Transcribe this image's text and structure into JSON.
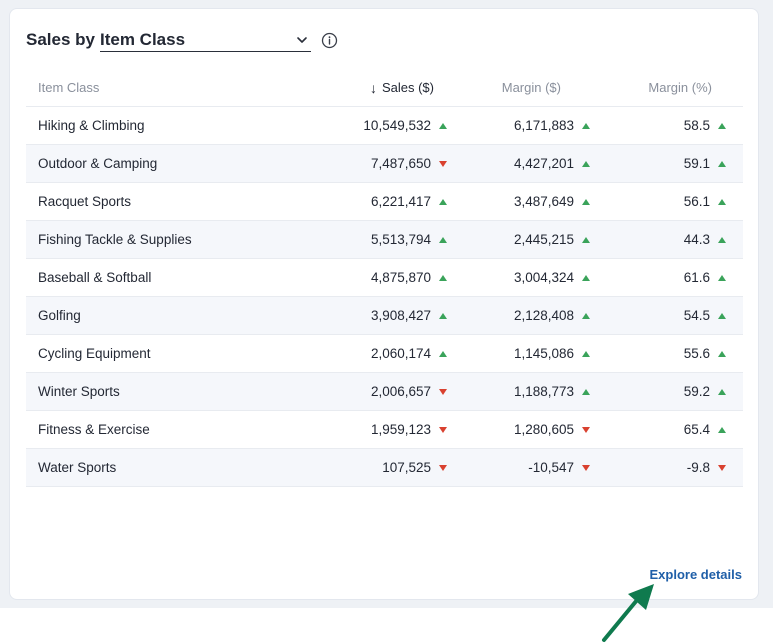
{
  "header": {
    "title_prefix": "Sales by",
    "dropdown_value": "Item Class"
  },
  "table": {
    "columns": {
      "item_class": "Item Class",
      "sales": "Sales ($)",
      "margin": "Margin ($)",
      "margin_pct": "Margin (%)"
    },
    "sort": {
      "column": "sales",
      "direction": "descending"
    },
    "rows": [
      {
        "item_class": "Hiking & Climbing",
        "sales": "10,549,532",
        "sales_trend": "up",
        "margin": "6,171,883",
        "margin_trend": "up",
        "margin_pct": "58.5",
        "pct_trend": "up"
      },
      {
        "item_class": "Outdoor & Camping",
        "sales": "7,487,650",
        "sales_trend": "down",
        "margin": "4,427,201",
        "margin_trend": "up",
        "margin_pct": "59.1",
        "pct_trend": "up"
      },
      {
        "item_class": "Racquet Sports",
        "sales": "6,221,417",
        "sales_trend": "up",
        "margin": "3,487,649",
        "margin_trend": "up",
        "margin_pct": "56.1",
        "pct_trend": "up"
      },
      {
        "item_class": "Fishing Tackle & Supplies",
        "sales": "5,513,794",
        "sales_trend": "up",
        "margin": "2,445,215",
        "margin_trend": "up",
        "margin_pct": "44.3",
        "pct_trend": "up"
      },
      {
        "item_class": "Baseball & Softball",
        "sales": "4,875,870",
        "sales_trend": "up",
        "margin": "3,004,324",
        "margin_trend": "up",
        "margin_pct": "61.6",
        "pct_trend": "up"
      },
      {
        "item_class": "Golfing",
        "sales": "3,908,427",
        "sales_trend": "up",
        "margin": "2,128,408",
        "margin_trend": "up",
        "margin_pct": "54.5",
        "pct_trend": "up"
      },
      {
        "item_class": "Cycling Equipment",
        "sales": "2,060,174",
        "sales_trend": "up",
        "margin": "1,145,086",
        "margin_trend": "up",
        "margin_pct": "55.6",
        "pct_trend": "up"
      },
      {
        "item_class": "Winter Sports",
        "sales": "2,006,657",
        "sales_trend": "down",
        "margin": "1,188,773",
        "margin_trend": "up",
        "margin_pct": "59.2",
        "pct_trend": "up"
      },
      {
        "item_class": "Fitness & Exercise",
        "sales": "1,959,123",
        "sales_trend": "down",
        "margin": "1,280,605",
        "margin_trend": "down",
        "margin_pct": "65.4",
        "pct_trend": "up"
      },
      {
        "item_class": "Water Sports",
        "sales": "107,525",
        "sales_trend": "down",
        "margin": "-10,547",
        "margin_trend": "down",
        "margin_pct": "-9.8",
        "pct_trend": "down"
      }
    ]
  },
  "footer": {
    "link_label": "Explore details"
  },
  "colors": {
    "trend_up": "#3aa35a",
    "trend_down": "#d9412f",
    "link": "#1f5fa8",
    "annotation_arrow": "#0f7a4e"
  },
  "icons": {
    "dropdown": "chevron-down-icon",
    "info": "info-icon",
    "sort": "arrow-down-icon",
    "trend_up": "triangle-up-icon",
    "trend_down": "triangle-down-icon"
  }
}
